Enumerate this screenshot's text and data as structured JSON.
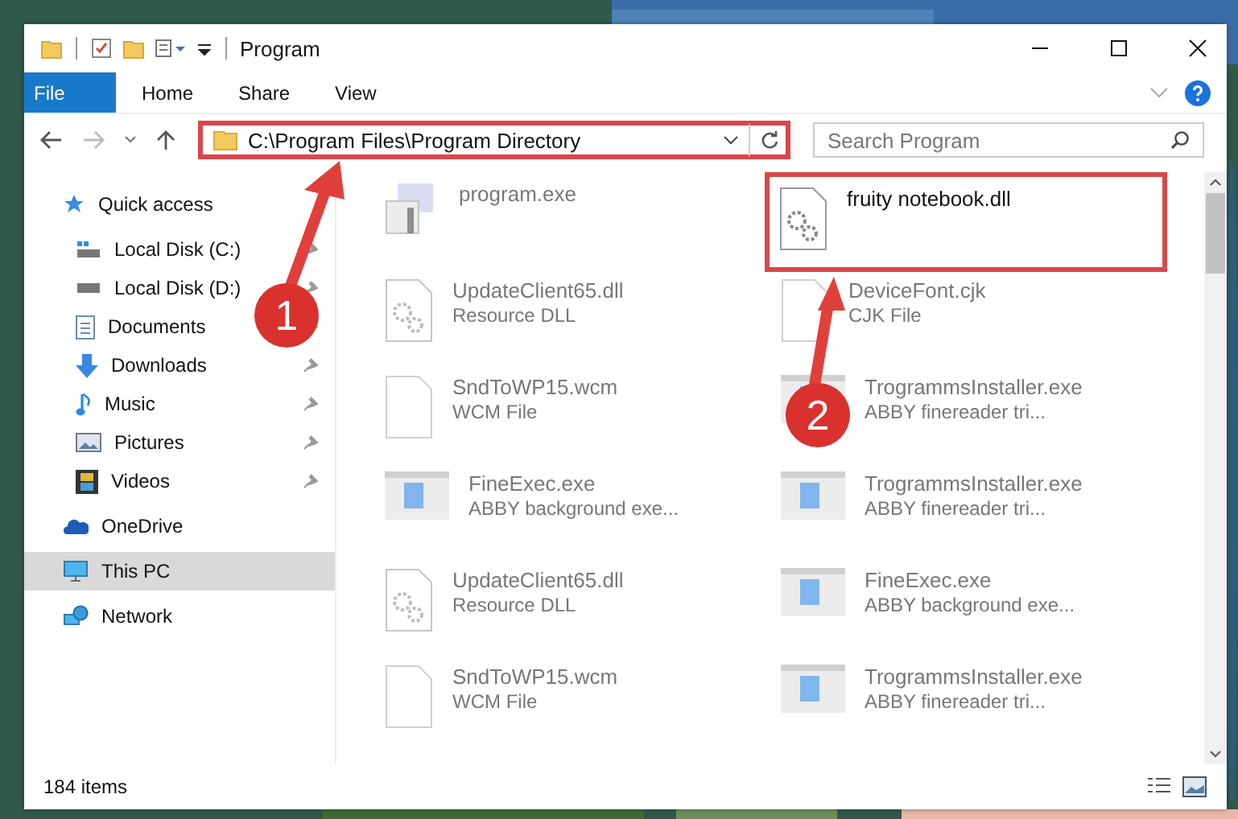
{
  "window": {
    "title": "Program"
  },
  "ribbon_tabs": [
    {
      "label": "File",
      "kind": "file"
    },
    {
      "label": "Home",
      "kind": "tab"
    },
    {
      "label": "Share",
      "kind": "tab"
    },
    {
      "label": "View",
      "kind": "tab"
    }
  ],
  "address_bar": {
    "path": "C:\\Program Files\\Program Directory",
    "highlighted": true
  },
  "search": {
    "placeholder": "Search Program"
  },
  "sidebar": {
    "items": [
      {
        "label": "Quick access",
        "kind": "star",
        "selected": false,
        "children": [
          {
            "label": "Local Disk (C:)",
            "kind": "windrive",
            "pinned": true,
            "selected": false
          },
          {
            "label": "Local Disk (D:)",
            "kind": "drive",
            "pinned": true,
            "selected": false
          },
          {
            "label": "Documents",
            "kind": "documents",
            "pinned": true,
            "selected": false
          },
          {
            "label": "Downloads",
            "kind": "downloads",
            "pinned": true,
            "selected": false
          },
          {
            "label": "Music",
            "kind": "music",
            "pinned": true,
            "selected": false
          },
          {
            "label": "Pictures",
            "kind": "pictures",
            "pinned": true,
            "selected": false
          },
          {
            "label": "Videos",
            "kind": "videos",
            "pinned": true,
            "selected": false
          }
        ]
      },
      {
        "label": "OneDrive",
        "kind": "cloud",
        "selected": false
      },
      {
        "label": "This PC",
        "kind": "pc",
        "selected": true
      },
      {
        "label": "Network",
        "kind": "network",
        "selected": false
      }
    ]
  },
  "files": [
    {
      "name": "program.exe",
      "kind": "installer",
      "dimmed": true,
      "highlighted": false
    },
    {
      "name": "fruity notebook.dll",
      "kind": "dll",
      "dimmed": false,
      "highlighted": true
    },
    {
      "name": "UpdateClient65.dll",
      "type": "Resource DLL",
      "kind": "dll",
      "dimmed": true,
      "highlighted": false
    },
    {
      "name": "DeviceFont.cjk",
      "type": "CJK File",
      "kind": "blank",
      "dimmed": true,
      "highlighted": false
    },
    {
      "name": "SndToWP15.wcm",
      "type": "WCM File",
      "kind": "blank",
      "dimmed": true,
      "highlighted": false
    },
    {
      "name": "TrogrammsInstaller.exe",
      "type": "ABBY finereader tri...",
      "kind": "app",
      "dimmed": true,
      "highlighted": false
    },
    {
      "name": "FineExec.exe",
      "type": "ABBY background exe...",
      "kind": "app",
      "dimmed": true,
      "highlighted": false
    },
    {
      "name": "TrogrammsInstaller.exe",
      "type": "ABBY finereader tri...",
      "kind": "app",
      "dimmed": true,
      "highlighted": false
    },
    {
      "name": "UpdateClient65.dll",
      "type": "Resource DLL",
      "kind": "dll",
      "dimmed": true,
      "highlighted": false
    },
    {
      "name": "FineExec.exe",
      "type": "ABBY background exe...",
      "kind": "app",
      "dimmed": true,
      "highlighted": false
    },
    {
      "name": "SndToWP15.wcm",
      "type": "WCM File",
      "kind": "blank",
      "dimmed": true,
      "highlighted": false
    },
    {
      "name": "TrogrammsInstaller.exe",
      "type": "ABBY finereader tri...",
      "kind": "app",
      "dimmed": true,
      "highlighted": false
    }
  ],
  "status_bar": {
    "count": "184 items"
  },
  "callouts": [
    {
      "label": "1"
    },
    {
      "label": "2"
    }
  ]
}
